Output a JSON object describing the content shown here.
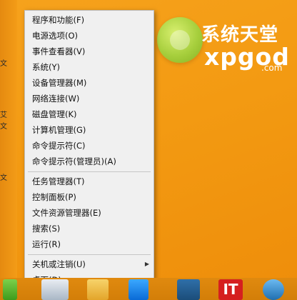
{
  "desktop": {
    "logo_cn": "系统天堂",
    "logo_en": "xpgod",
    "logo_dotcom": ".com"
  },
  "left_edge_texts": [
    "文",
    "艾",
    "文",
    "文"
  ],
  "menu": {
    "items": [
      {
        "label": "程序和功能(F)"
      },
      {
        "label": "电源选项(O)"
      },
      {
        "label": "事件查看器(V)"
      },
      {
        "label": "系统(Y)"
      },
      {
        "label": "设备管理器(M)"
      },
      {
        "label": "网络连接(W)"
      },
      {
        "label": "磁盘管理(K)"
      },
      {
        "label": "计算机管理(G)"
      },
      {
        "label": "命令提示符(C)"
      },
      {
        "label": "命令提示符(管理员)(A)"
      },
      {
        "label": "任务管理器(T)"
      },
      {
        "label": "控制面板(P)"
      },
      {
        "label": "文件资源管理器(E)"
      },
      {
        "label": "搜索(S)"
      },
      {
        "label": "运行(R)"
      },
      {
        "label": "关机或注销(U)",
        "has_submenu": true
      },
      {
        "label": "桌面(D)"
      }
    ]
  },
  "taskbar": {
    "icons": [
      "start-icon",
      "app-icon",
      "folder-icon",
      "store-icon",
      "ithome-icon",
      "bird-icon"
    ],
    "ithome_text": "IT"
  }
}
